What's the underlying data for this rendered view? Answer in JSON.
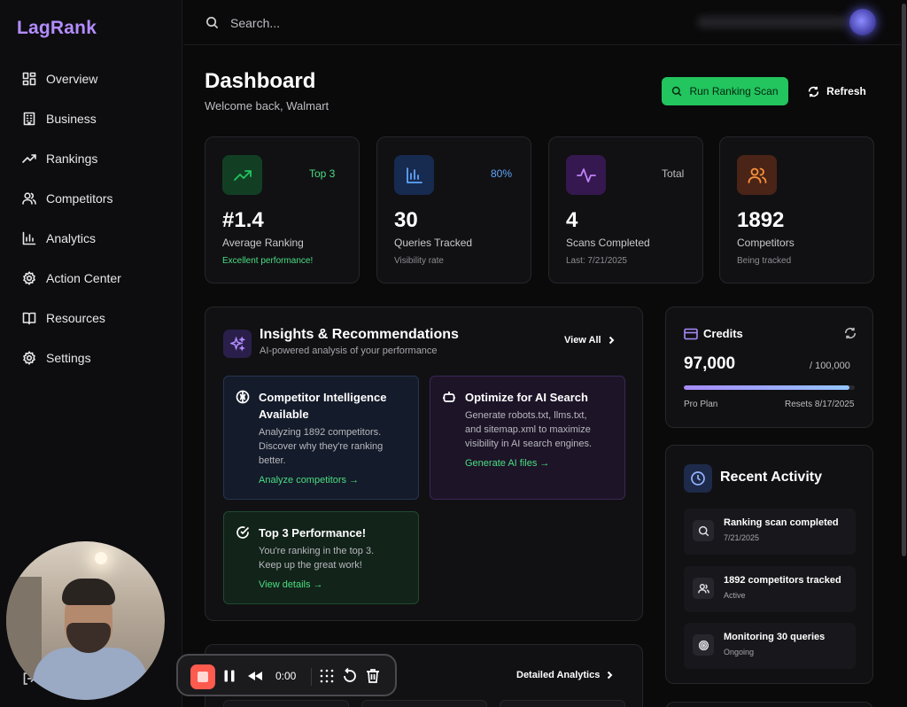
{
  "app": {
    "name": "LagRank"
  },
  "sidebar": {
    "items": [
      {
        "label": "Overview",
        "icon": "overview-icon"
      },
      {
        "label": "Business",
        "icon": "building-icon"
      },
      {
        "label": "Rankings",
        "icon": "trending-up-icon"
      },
      {
        "label": "Competitors",
        "icon": "users-icon"
      },
      {
        "label": "Analytics",
        "icon": "bar-chart-icon"
      },
      {
        "label": "Action Center",
        "icon": "gear-icon"
      },
      {
        "label": "Resources",
        "icon": "book-icon"
      },
      {
        "label": "Settings",
        "icon": "settings-icon"
      }
    ]
  },
  "search": {
    "placeholder": "Search..."
  },
  "header": {
    "title": "Dashboard",
    "subtitle": "Welcome back, Walmart",
    "run_scan_label": "Run Ranking Scan",
    "refresh_label": "Refresh"
  },
  "stats": [
    {
      "badge": "Top 3",
      "value": "#1.4",
      "label": "Average Ranking",
      "note": "Excellent performance!",
      "color": "#22c55e",
      "icon": "trending-up-icon"
    },
    {
      "badge": "80%",
      "value": "30",
      "label": "Queries Tracked",
      "note": "Visibility rate",
      "color": "#60a5fa",
      "icon": "bar-chart-icon"
    },
    {
      "badge": "Total",
      "value": "4",
      "label": "Scans Completed",
      "note": "Last: 7/21/2025",
      "color": "#c084fc",
      "icon": "activity-icon"
    },
    {
      "badge": "",
      "value": "1892",
      "label": "Competitors",
      "note": "Being tracked",
      "color": "#fb923c",
      "icon": "users-icon"
    }
  ],
  "insights": {
    "title": "Insights & Recommendations",
    "subtitle": "AI-powered analysis of your performance",
    "view_all": "View All",
    "cards": [
      {
        "title_lines": [
          "Competitor Intelligence",
          "Available"
        ],
        "body_lines": [
          "Analyzing 1892 competitors.",
          "Discover why they're ranking",
          "better."
        ],
        "link": "Analyze competitors →",
        "icon": "brain-icon"
      },
      {
        "title_lines": [
          "Optimize for AI Search"
        ],
        "body_lines": [
          "Generate robots.txt, llms.txt,",
          "and sitemap.xml to maximize",
          "visibility in AI search engines."
        ],
        "link": "Generate AI files →",
        "icon": "bot-icon"
      },
      {
        "title_lines": [
          "Top 3 Performance!"
        ],
        "body_lines": [
          "You're ranking in the top 3.",
          "Keep up the great work!"
        ],
        "link": "View details →",
        "icon": "check-circle-icon"
      }
    ]
  },
  "credits": {
    "title": "Credits",
    "value": "97,000",
    "total": "/ 100,000",
    "fraction_used": 0.97,
    "plan": "Pro Plan",
    "resets": "Resets 8/17/2025"
  },
  "activity": {
    "title": "Recent Activity",
    "items": [
      {
        "title": "Ranking scan completed",
        "sub": "7/21/2025",
        "icon": "search-icon"
      },
      {
        "title": "1892 competitors tracked",
        "sub": "Active",
        "icon": "users-icon"
      },
      {
        "title": "Monitoring 30 queries",
        "sub": "Ongoing",
        "icon": "target-icon"
      }
    ]
  },
  "analytics_card": {
    "link": "Detailed Analytics"
  },
  "recorder": {
    "time": "0:00"
  }
}
